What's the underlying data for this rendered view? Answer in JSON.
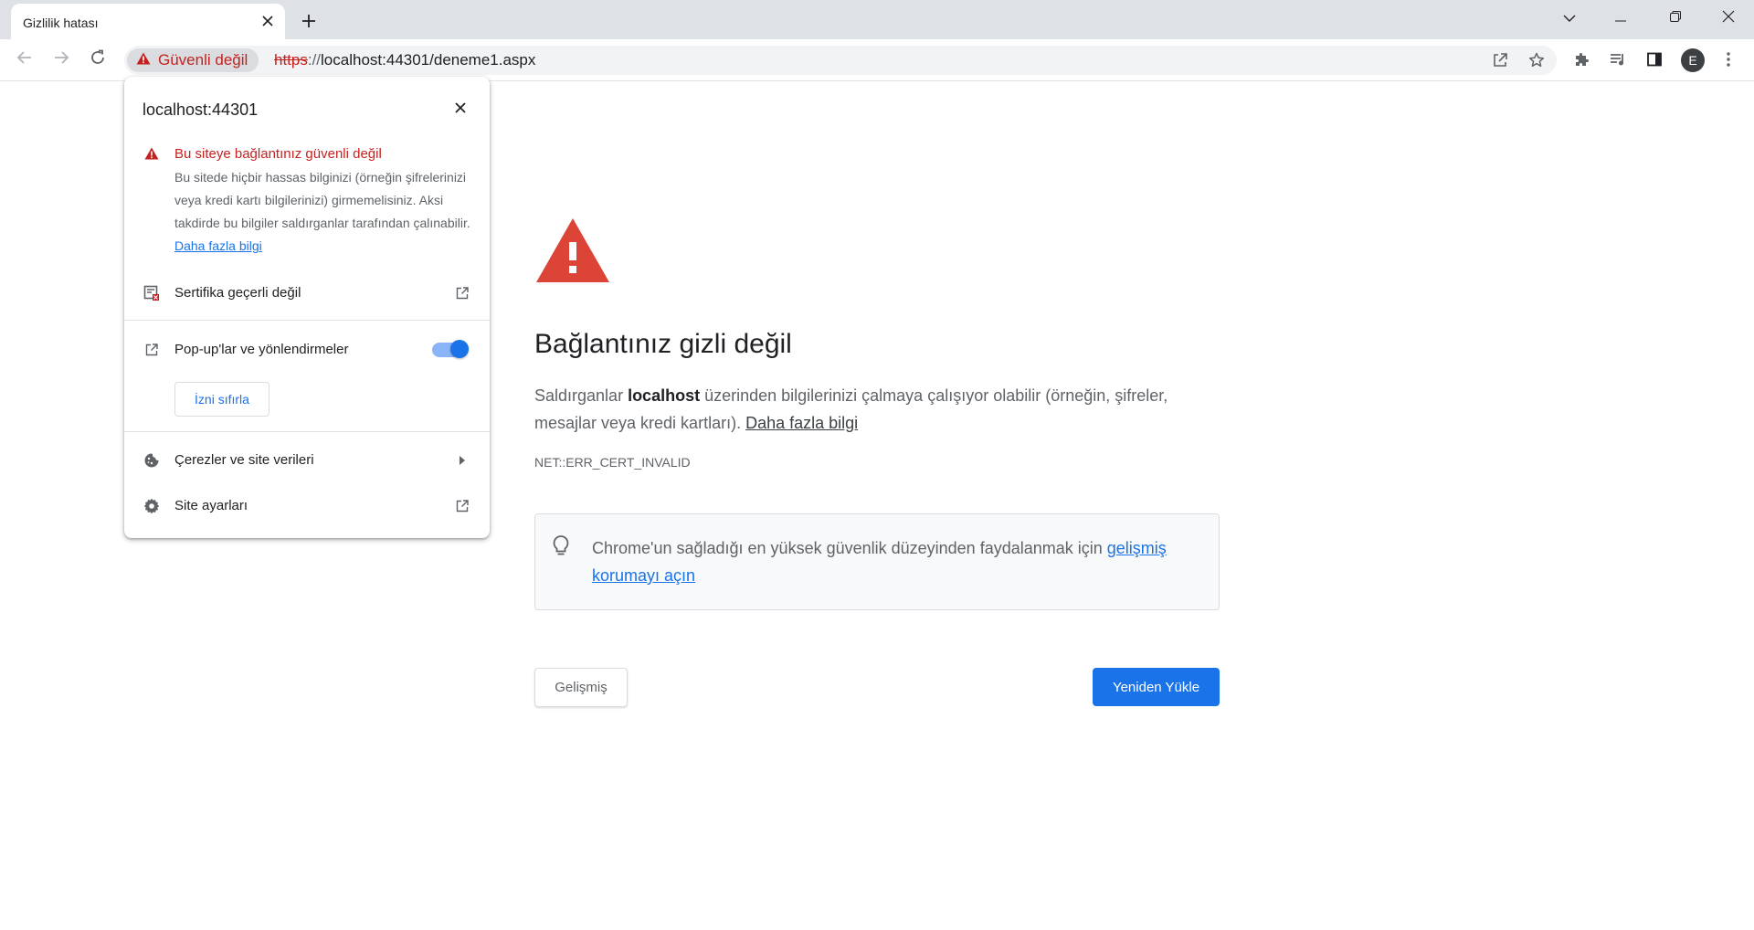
{
  "tab": {
    "title": "Gizlilik hatası"
  },
  "omnibox": {
    "security_chip": "Güvenli değil",
    "url_scheme": "https",
    "url_sep": "://",
    "url_host": "localhost",
    "url_rest": ":44301/deneme1.aspx"
  },
  "profile": {
    "initial": "E"
  },
  "page": {
    "heading": "Bağlantınız gizli değil",
    "desc_prefix": "Saldırganlar ",
    "desc_host": "localhost",
    "desc_suffix": " üzerinden bilgilerinizi çalmaya çalışıyor olabilir (örneğin, şifreler, mesajlar veya kredi kartları). ",
    "desc_link": "Daha fazla bilgi",
    "error_code": "NET::ERR_CERT_INVALID",
    "tip_text": "Chrome'un sağladığı en yüksek güvenlik düzeyinden faydalanmak için ",
    "tip_link": "gelişmiş korumayı açın",
    "advanced_button": "Gelişmiş",
    "reload_button": "Yeniden Yükle"
  },
  "popup": {
    "title": "localhost:44301",
    "warning_title": "Bu siteye bağlantınız güvenli değil",
    "warning_body": "Bu sitede hiçbir hassas bilginizi (örneğin şifrelerinizi veya kredi kartı bilgilerinizi) girmemelisiniz. Aksi takdirde bu bilgiler saldırganlar tarafından çalınabilir. ",
    "warning_link": "Daha fazla bilgi",
    "certificate": "Sertifika geçerli değil",
    "popups": "Pop-up'lar ve yönlendirmeler",
    "reset_permission": "İzni sıfırla",
    "cookies": "Çerezler ve site verileri",
    "site_settings": "Site ayarları"
  },
  "colors": {
    "danger": "#c5221f",
    "accent": "#1a73e8",
    "warning_triangle": "#db4437"
  }
}
